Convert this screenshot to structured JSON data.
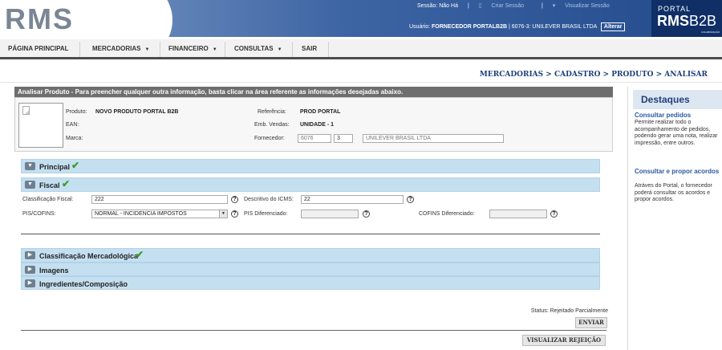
{
  "header": {
    "logo_text": "RMS",
    "session_label": "Sessão: Não Há",
    "create_session": "Criar Sessão",
    "view_session": "Visualizar Sessão",
    "user_label": "Usuário:",
    "user_name": "FORNECEDOR PORTALB2B",
    "user_company": "| 6076-3: UNILEVER BRASIL LTDA",
    "change_button": "Alterar",
    "portal_small": "PORTAL",
    "portal_big_bold": "RMS",
    "portal_big_thin": "B2B",
    "portal_tiny": "COLABORAÇÃO"
  },
  "nav": {
    "items": [
      {
        "label": "PÁGINA PRINCIPAL"
      },
      {
        "label": "MERCADORIAS"
      },
      {
        "label": "FINANCEIRO"
      },
      {
        "label": "CONSULTAS"
      },
      {
        "label": "SAIR"
      }
    ]
  },
  "breadcrumb": "MERCADORIAS > CADASTRO > PRODUTO > ANALISAR",
  "panel": {
    "title": "Analisar Produto - Para preencher qualquer outra informação, basta clicar na área referente as informações desejadas abaixo."
  },
  "product": {
    "produto_label": "Produto:",
    "produto_value": "NOVO PRODUTO PORTAL B2B",
    "ean_label": "EAN:",
    "marca_label": "Marca:",
    "referencia_label": "Referência:",
    "referencia_value": "PROD PORTAL",
    "emb_label": "Emb. Vendas:",
    "emb_value": "UNIDADE - 1",
    "fornecedor_label": "Fornecedor:",
    "fornecedor_code": "6076",
    "fornecedor_digit": "3",
    "fornecedor_name": "UNILEVER BRASIL LTDA"
  },
  "sections": {
    "principal": "Principal",
    "fiscal": "Fiscal",
    "classificacao": "Classificação Mercadológica",
    "imagens": "Imagens",
    "ingredientes": "Ingredientes/Composição"
  },
  "fiscal": {
    "class_label": "Classificação Fiscal:",
    "class_value": "222",
    "icms_label": "Descritivo do ICMS:",
    "icms_value": "22",
    "pis_label": "PIS/COFINS:",
    "pis_value": "NORMAL - INCIDENCIA IMPOSTOS",
    "pis_dif_label": "PIS Diferenciado:",
    "cofins_dif_label": "COFINS Diferenciado:",
    "help": "?"
  },
  "footer": {
    "status": "Status: Rejeitado Parcialmente",
    "send_button": "ENVIAR",
    "view_rejection_button": "VISUALIZAR REJEIÇÃO"
  },
  "sidebar": {
    "title": "Destaques",
    "link1": "Consultar pedidos",
    "text1": "Permite realizar todo o acompanhamento de pedidos, podendo gerar uma nota, realizar impressão, entre outros.",
    "link2": "Consultar e propor acordos",
    "text2": "Atráves do Portal, o fornecedor poderá consultar os acordos e propor acordos."
  },
  "colors": {
    "brand_blue": "#234b8c",
    "section_bg": "#c4dff0",
    "accent_orange": "#f29a1f",
    "check_green": "#3a9c2a"
  }
}
